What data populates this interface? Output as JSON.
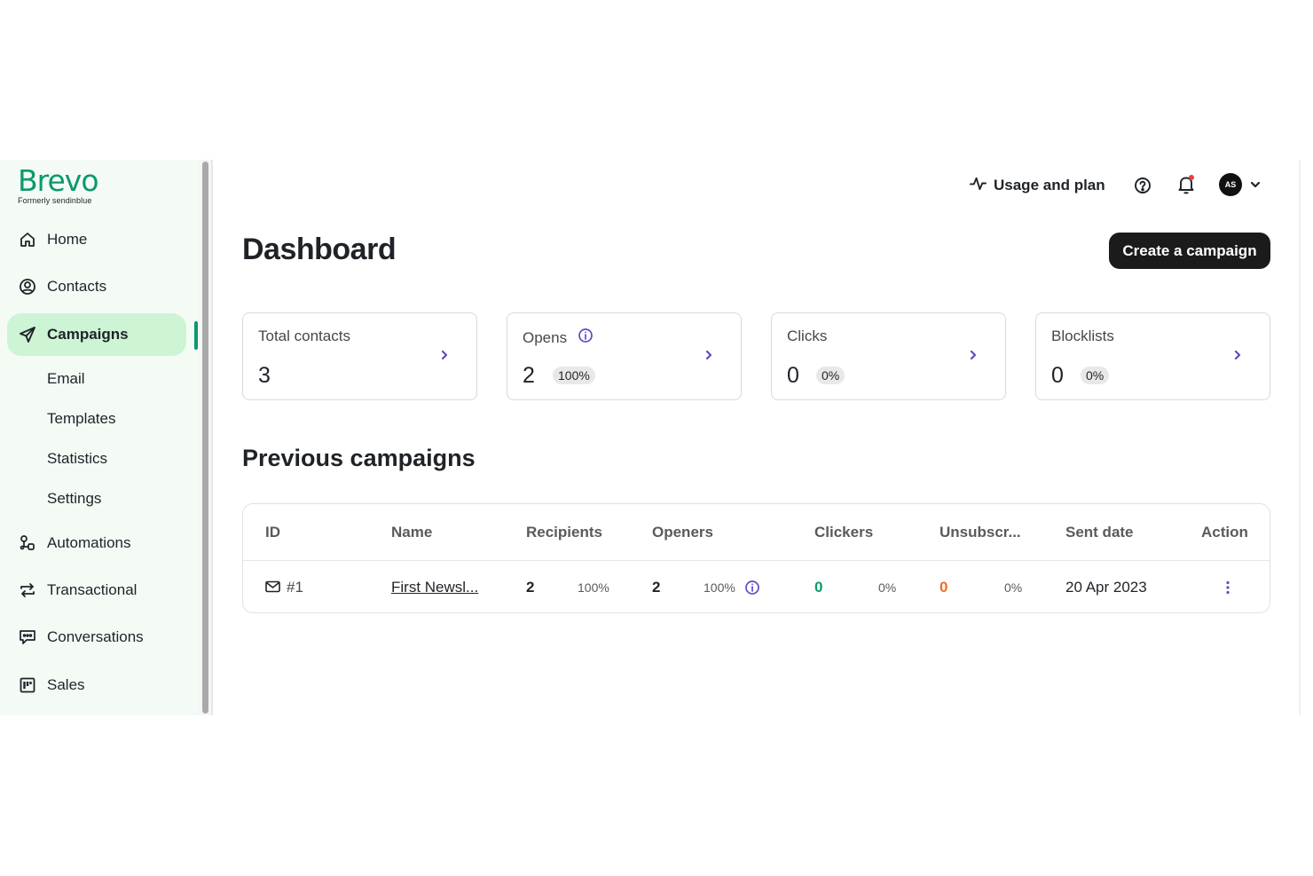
{
  "brand": {
    "name": "Brevo",
    "tagline": "Formerly sendinblue",
    "color": "#0b996e"
  },
  "sidebar": {
    "items": [
      {
        "label": "Home",
        "icon": "home-icon"
      },
      {
        "label": "Contacts",
        "icon": "contacts-icon"
      },
      {
        "label": "Campaigns",
        "icon": "send-icon",
        "active": true
      },
      {
        "label": "Automations",
        "icon": "automations-icon"
      },
      {
        "label": "Transactional",
        "icon": "transactional-icon"
      },
      {
        "label": "Conversations",
        "icon": "chat-icon"
      },
      {
        "label": "Sales",
        "icon": "kanban-icon"
      }
    ],
    "campaign_subitems": [
      "Email",
      "Templates",
      "Statistics",
      "Settings"
    ]
  },
  "topbar": {
    "usage_label": "Usage and plan",
    "avatar_initials": "AS"
  },
  "page": {
    "title": "Dashboard",
    "create_button": "Create a campaign",
    "section_title": "Previous campaigns"
  },
  "stats": [
    {
      "title": "Total contacts",
      "value": "3"
    },
    {
      "title": "Opens",
      "value": "2",
      "percent": "100%",
      "info": true
    },
    {
      "title": "Clicks",
      "value": "0",
      "percent": "0%"
    },
    {
      "title": "Blocklists",
      "value": "0",
      "percent": "0%"
    }
  ],
  "table": {
    "headers": [
      "ID",
      "Name",
      "Recipients",
      "Openers",
      "Clickers",
      "Unsubscr...",
      "Sent date",
      "Action"
    ],
    "rows": [
      {
        "id": "#1",
        "name": "First Newsl...",
        "recipients": "2",
        "recipients_pct": "100%",
        "openers": "2",
        "openers_pct": "100%",
        "clickers": "0",
        "clickers_pct": "0%",
        "unsubscribers": "0",
        "unsubscribers_pct": "0%",
        "sent_date": "20 Apr 2023"
      }
    ]
  },
  "colors": {
    "accent_green": "#0b996e",
    "active_bg": "#cdf4d4",
    "sidebar_bg": "#f4fbf5",
    "link_purple": "#5b4cc8",
    "orange": "#f36b21"
  }
}
